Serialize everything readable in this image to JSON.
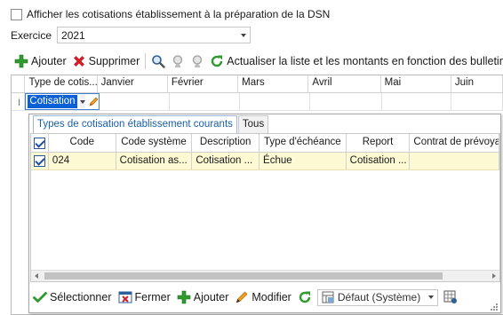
{
  "top_checkbox": {
    "label": "Afficher les cotisations établissement à la préparation de la DSN",
    "checked": false
  },
  "exercice": {
    "label": "Exercice",
    "value": "2021"
  },
  "toolbar": {
    "add_label": "Ajouter",
    "delete_label": "Supprimer",
    "refresh_label": "Actualiser la liste et les montants en fonction des bulletins"
  },
  "grid": {
    "columns": [
      "Type de cotis...",
      "Janvier",
      "Février",
      "Mars",
      "Avril",
      "Mai",
      "Juin"
    ],
    "editor_value": "Cotisation"
  },
  "popup": {
    "tabs": [
      "Types de cotisation établissement courants",
      "Tous"
    ],
    "columns": [
      "Code",
      "Code système",
      "Description",
      "Type d'échéance",
      "Report",
      "Contrat de prévoyance"
    ],
    "rows": [
      {
        "checked": true,
        "code": "024",
        "code_systeme": "Cotisation as...",
        "description": "Cotisation ...",
        "type_echeance": "Échue",
        "report": "Cotisation ...",
        "contrat": ""
      }
    ],
    "bottom_bar": {
      "select_label": "Sélectionner",
      "close_label": "Fermer",
      "add_label": "Ajouter",
      "edit_label": "Modifier",
      "view_select_value": "Défaut (Système)"
    }
  },
  "colors": {
    "accent": "#0b60d6",
    "row_highlight": "#fcf9d3",
    "green": "#2f9a2f",
    "red": "#d0202a"
  }
}
